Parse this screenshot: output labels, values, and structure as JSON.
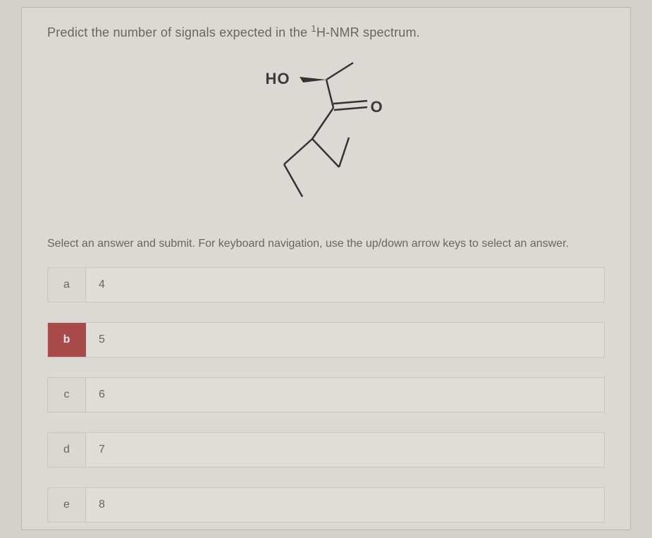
{
  "question": {
    "text_before_sup": "Predict the number of signals expected in the ",
    "sup": "1",
    "text_after_sup": "H-NMR spectrum."
  },
  "structure": {
    "ho": "HO",
    "o": "O"
  },
  "instructions": "Select an answer and submit. For keyboard navigation, use the up/down arrow keys to select an answer.",
  "options": [
    {
      "letter": "a",
      "value": "4",
      "selected": false
    },
    {
      "letter": "b",
      "value": "5",
      "selected": true
    },
    {
      "letter": "c",
      "value": "6",
      "selected": false
    },
    {
      "letter": "d",
      "value": "7",
      "selected": false
    },
    {
      "letter": "e",
      "value": "8",
      "selected": false
    }
  ]
}
